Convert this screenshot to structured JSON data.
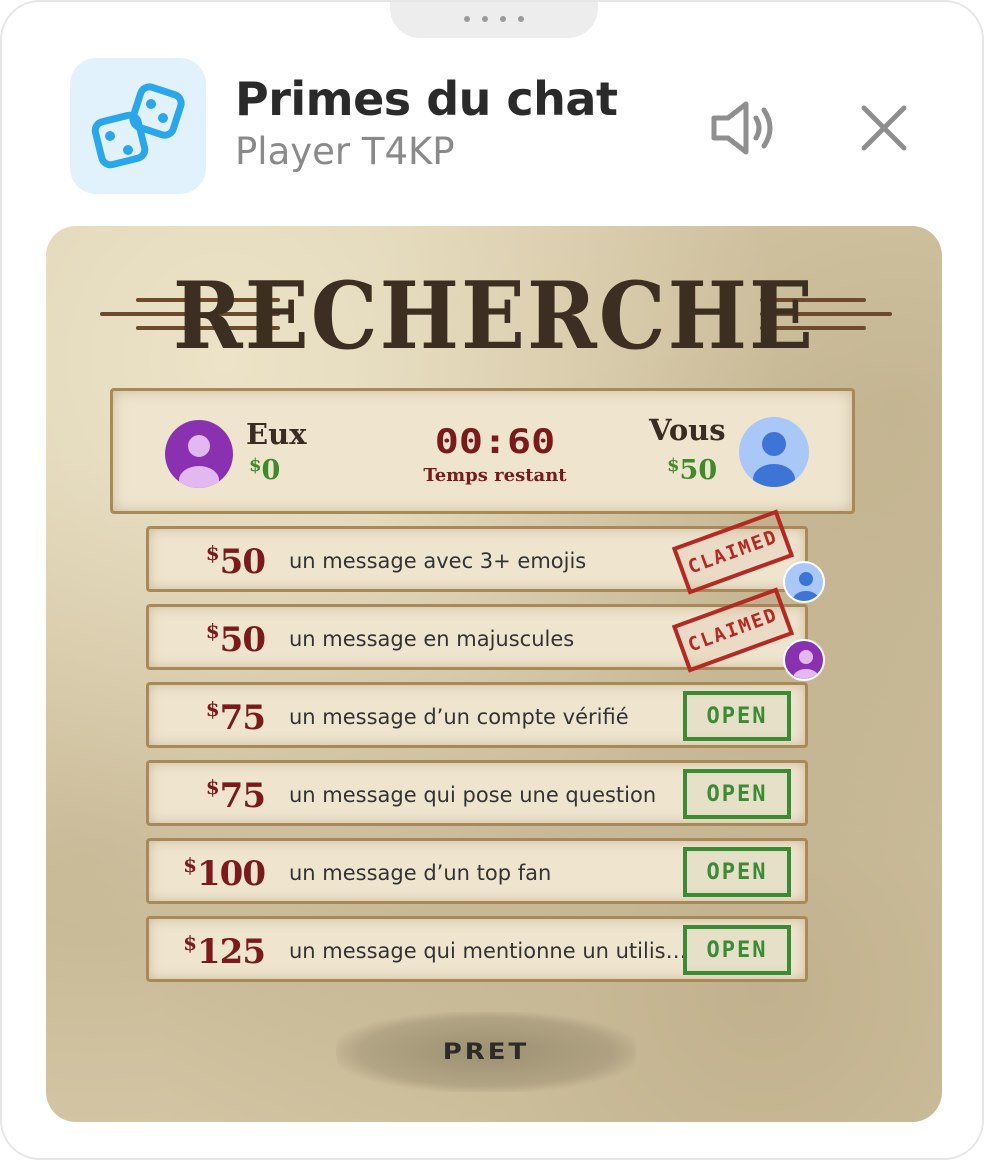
{
  "header": {
    "app_icon": "dice-icon",
    "title": "Primes du chat",
    "subtitle": "Player T4KP",
    "sound_icon": "speaker-icon",
    "close_icon": "close-icon"
  },
  "poster": {
    "title": "RECHERCHE",
    "scoreboard": {
      "them": {
        "name": "Eux",
        "currency": "$",
        "amount": "0"
      },
      "you": {
        "name": "Vous",
        "currency": "$",
        "amount": "50"
      },
      "timer": "00:60",
      "timer_label": "Temps restant"
    },
    "bounties": [
      {
        "currency": "$",
        "amount": "50",
        "description": "un message avec 3+ emojis",
        "status": "CLAIMED",
        "claimed_by": "you"
      },
      {
        "currency": "$",
        "amount": "50",
        "description": "un message en majuscules",
        "status": "CLAIMED",
        "claimed_by": "them"
      },
      {
        "currency": "$",
        "amount": "75",
        "description": "un message d’un compte vérifié",
        "status": "OPEN"
      },
      {
        "currency": "$",
        "amount": "75",
        "description": "un message qui pose une question",
        "status": "OPEN"
      },
      {
        "currency": "$",
        "amount": "100",
        "description": "un message d’un top fan",
        "status": "OPEN"
      },
      {
        "currency": "$",
        "amount": "125",
        "description": "un message qui mentionne un utilis…",
        "status": "OPEN"
      }
    ],
    "ready_label": "PRET"
  },
  "colors": {
    "accent_blue": "#2aa7ea",
    "paper": "#d9ccaa",
    "ink_red": "#7a1a1c",
    "open_green": "#3b8a34",
    "claimed_red": "#b42a22",
    "money_green": "#3f8b2a",
    "them_avatar": "#8a31b1",
    "you_avatar": "#a9c8f8"
  }
}
